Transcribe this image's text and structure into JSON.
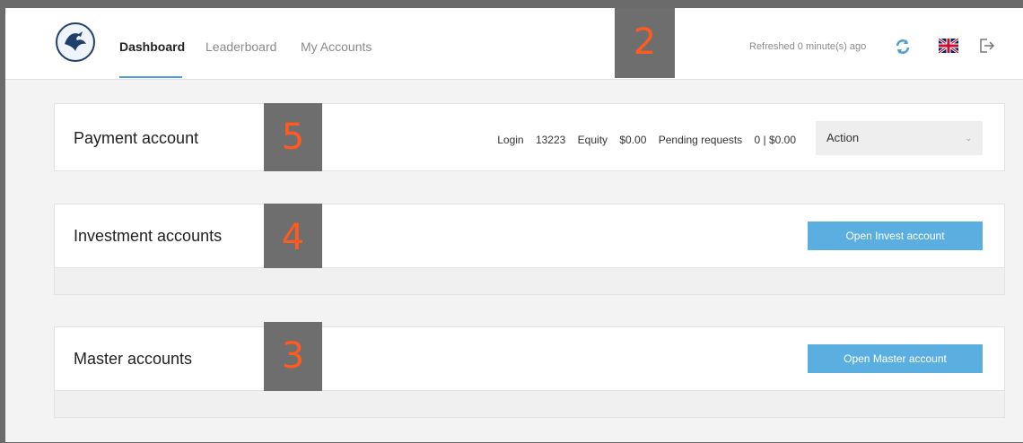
{
  "header": {
    "nav": [
      "Dashboard",
      "Leaderboard",
      "My Accounts"
    ],
    "refreshed_text": "Refreshed 0 minute(s) ago",
    "icons": {
      "logo": "company-logo",
      "refresh": "refresh-icon",
      "flag": "uk-flag-icon",
      "logout": "logout-icon"
    }
  },
  "badges": [
    "2",
    "5",
    "4",
    "3"
  ],
  "payment": {
    "title": "Payment account",
    "login_label": "Login",
    "login_value": "13223",
    "equity_label": "Equity",
    "equity_value": "$0.00",
    "pending_label": "Pending requests",
    "pending_value": "0 | $0.00",
    "action": "Action"
  },
  "investment": {
    "title": "Investment accounts",
    "button": "Open Invest account"
  },
  "master": {
    "title": "Master accounts",
    "button": "Open Master account"
  },
  "colors": {
    "accent": "#5aaee0",
    "badge_bg": "#6e6e6e",
    "badge_text": "#ff5a1f"
  }
}
